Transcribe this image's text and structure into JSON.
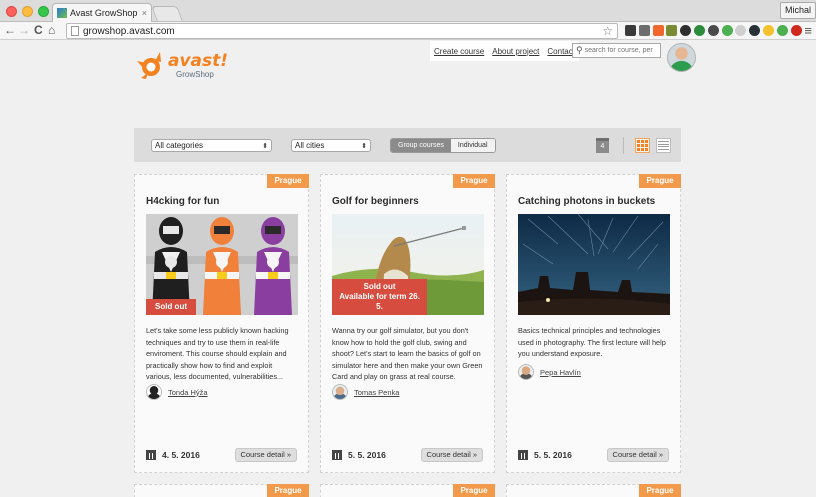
{
  "browser": {
    "tab_title": "Avast GrowShop | Avast | G",
    "tab_close": "×",
    "profile": "Michal",
    "url": "growshop.avast.com",
    "back": "←",
    "forward": "→",
    "reload": "C",
    "home": "⌂",
    "bookmark": "☆",
    "menu": "≡",
    "extension_colors": [
      "#3a3a3a",
      "#6d6d6d",
      "#f0682e",
      "#7a8b32",
      "#2f2f2f",
      "#2d8c3c",
      "#4b4b4b",
      "#4caf50",
      "#cfcfcf",
      "#263238",
      "#f6c12e",
      "#4caf50",
      "#d0281f"
    ]
  },
  "site": {
    "logo_text": "avast!",
    "logo_sub": "GrowShop",
    "nav": [
      "Create course",
      "About project",
      "Contact"
    ],
    "search_placeholder": "search for course, per"
  },
  "filters": {
    "category": "All categories",
    "city": "All cities",
    "mode_options": [
      "Group courses",
      "Individual"
    ],
    "mode_selected": "Group courses",
    "calendar_day": "4",
    "select_arrow": "⬍"
  },
  "cards": [
    {
      "badge": "Prague",
      "title": "H4cking for fun",
      "sold_out": "Sold out",
      "sold_note": "",
      "description": "Let's take some less publicly known hacking techniques and try to use them in real-life enviroment. This course should explain and practically show how to find and exploit various, less documented, vulnerabilities...",
      "teacher": "Tonda Hýža",
      "date": "4. 5. 2016",
      "detail": "Course detail »"
    },
    {
      "badge": "Prague",
      "title": "Golf for beginners",
      "sold_out": "Sold out",
      "sold_note": "Available for term 26. 5.",
      "description": "Wanna try our golf simulator, but you don't know how to hold the golf club, swing and shoot? Let's start to learn the basics of golf on simulator here and then make your own Green Card and play on grass at real course.",
      "teacher": "Tomas Penka",
      "date": "5. 5. 2016",
      "detail": "Course detail »"
    },
    {
      "badge": "Prague",
      "title": "Catching photons in buckets",
      "sold_out": "",
      "sold_note": "",
      "description": "Basics technical principles and technologies used in photography. The first lecture will help you understand exposure.",
      "teacher": "Pepa Havlín",
      "date": "5. 5. 2016",
      "detail": "Course detail »"
    }
  ],
  "next_row_badges": [
    "Prague",
    "Prague",
    "Prague"
  ]
}
